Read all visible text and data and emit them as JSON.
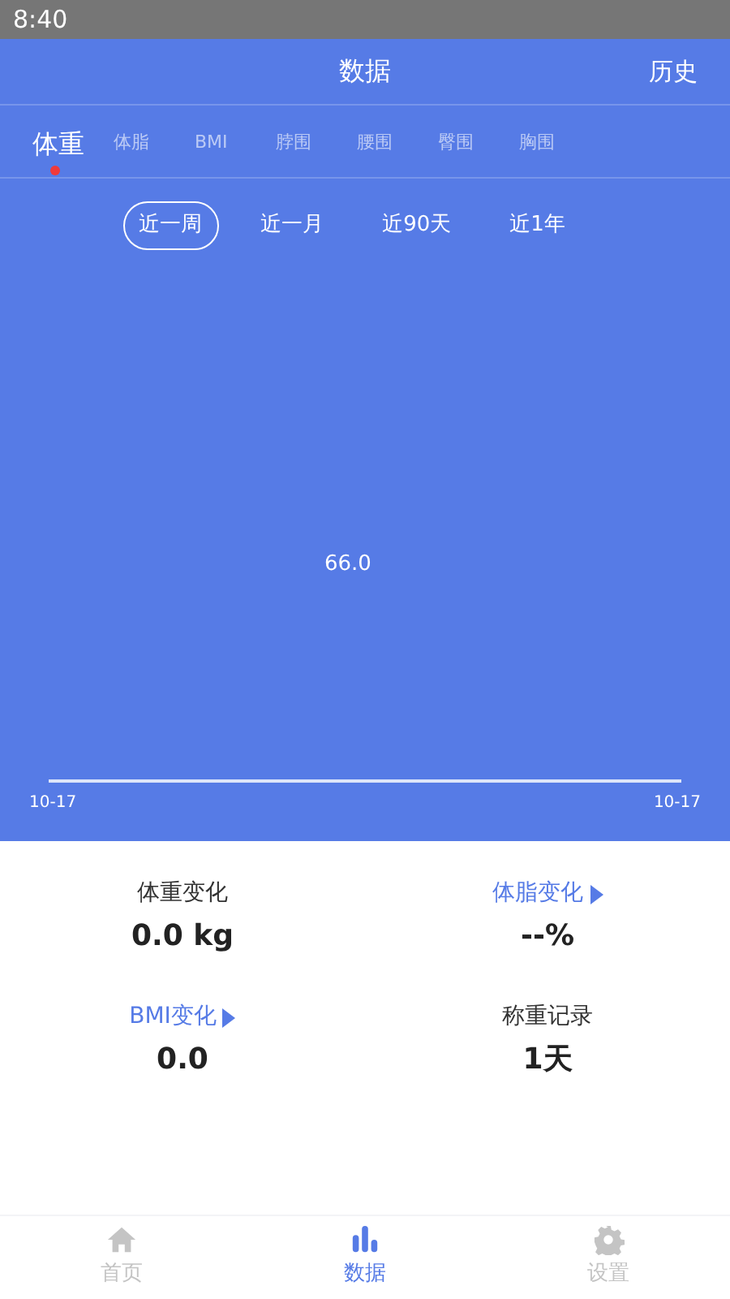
{
  "status_bar": {
    "time": "8:40"
  },
  "header": {
    "title": "数据",
    "action": "历史"
  },
  "tabs": [
    {
      "label": "体重",
      "selected": true
    },
    {
      "label": "体脂",
      "selected": false
    },
    {
      "label": "BMI",
      "selected": false
    },
    {
      "label": "脖围",
      "selected": false
    },
    {
      "label": "腰围",
      "selected": false
    },
    {
      "label": "臀围",
      "selected": false
    },
    {
      "label": "胸围",
      "selected": false
    }
  ],
  "ranges": [
    {
      "label": "近一周",
      "selected": true
    },
    {
      "label": "近一月",
      "selected": false
    },
    {
      "label": "近90天",
      "selected": false
    },
    {
      "label": "近1年",
      "selected": false
    }
  ],
  "chart": {
    "value_label": "66.0",
    "x_start": "10-17",
    "x_end": "10-17"
  },
  "stats": [
    {
      "kind": "plain",
      "label": "体重变化",
      "value": "0.0 kg"
    },
    {
      "kind": "link",
      "label": "体脂变化",
      "value": "--%"
    },
    {
      "kind": "link",
      "label": "BMI变化",
      "value": "0.0"
    },
    {
      "kind": "plain",
      "label": "称重记录",
      "value": "1天"
    }
  ],
  "bottom_nav": [
    {
      "kind": "home",
      "label": "首页",
      "selected": false
    },
    {
      "kind": "data",
      "label": "数据",
      "selected": true
    },
    {
      "kind": "settings",
      "label": "设置",
      "selected": false
    }
  ]
}
